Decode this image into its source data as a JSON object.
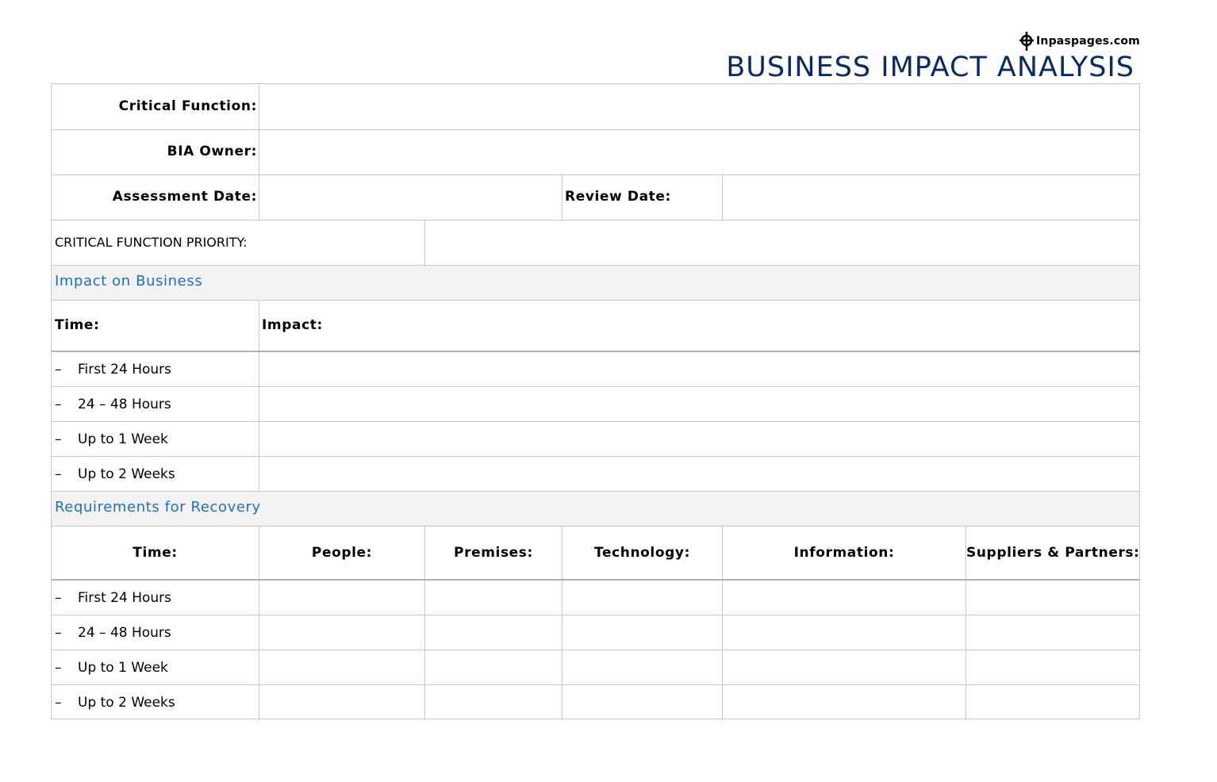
{
  "brand": {
    "name": "Inpaspages.com",
    "icon": "crosshair-pin-icon"
  },
  "title": "BUSINESS IMPACT ANALYSIS",
  "form": {
    "critical_function_label": "Critical Function:",
    "critical_function_value": "",
    "bia_owner_label": "BIA Owner:",
    "bia_owner_value": "",
    "assessment_date_label": "Assessment Date:",
    "assessment_date_value": "",
    "review_date_label": "Review Date:",
    "review_date_value": "",
    "priority_label": "CRITICAL FUNCTION PRIORITY:",
    "priority_value": ""
  },
  "impact_section": {
    "heading": "Impact on Business",
    "col_time": "Time:",
    "col_impact": "Impact:",
    "dash": "–",
    "rows": [
      {
        "time": "First 24 Hours",
        "impact": ""
      },
      {
        "time": "24 – 48 Hours",
        "impact": ""
      },
      {
        "time": "Up to 1 Week",
        "impact": ""
      },
      {
        "time": "Up to 2 Weeks",
        "impact": ""
      }
    ]
  },
  "recovery_section": {
    "heading": "Requirements for Recovery",
    "columns": [
      "Time:",
      "People:",
      "Premises:",
      "Technology:",
      "Information:",
      "Suppliers & Partners:"
    ],
    "dash": "–",
    "rows": [
      {
        "time": "First 24 Hours"
      },
      {
        "time": "24 – 48 Hours"
      },
      {
        "time": "Up to 1 Week"
      },
      {
        "time": "Up to 2 Weeks"
      }
    ]
  },
  "colors": {
    "title": "#0b2a66",
    "section_heading": "#1f6fbf",
    "band": "#f2f2f2",
    "grid": "#c8c8c8"
  }
}
